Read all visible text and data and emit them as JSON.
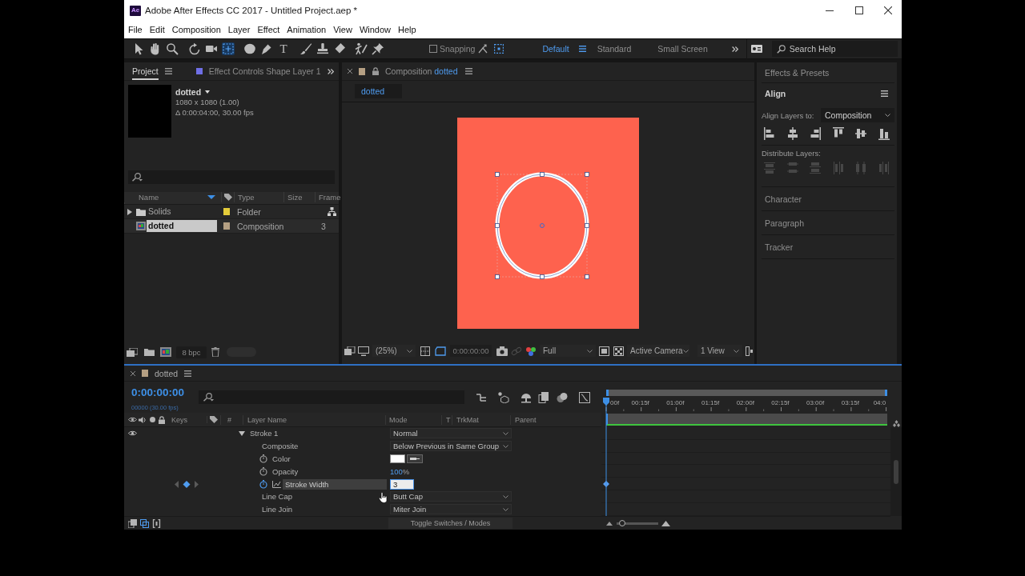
{
  "window": {
    "app_icon": "Ae",
    "title": "Adobe After Effects CC 2017 - Untitled Project.aep *"
  },
  "menu": [
    "File",
    "Edit",
    "Composition",
    "Layer",
    "Effect",
    "Animation",
    "View",
    "Window",
    "Help"
  ],
  "toolbar": {
    "tools": [
      {
        "kind": "selection",
        "selected": false
      },
      {
        "kind": "hand",
        "selected": false
      },
      {
        "kind": "zoom",
        "selected": false
      },
      {
        "kind": "rotate",
        "selected": false
      },
      {
        "kind": "camera",
        "selected": false
      },
      {
        "kind": "pan-behind",
        "selected": true
      },
      {
        "kind": "ellipse",
        "selected": false
      },
      {
        "kind": "pen",
        "selected": false
      },
      {
        "kind": "type",
        "glyph": "T",
        "selected": false
      },
      {
        "kind": "brush",
        "selected": false
      },
      {
        "kind": "stamp",
        "selected": false
      },
      {
        "kind": "eraser",
        "selected": false
      },
      {
        "kind": "roto",
        "selected": false
      },
      {
        "kind": "puppet",
        "selected": false
      }
    ],
    "snapping": {
      "label": "Snapping",
      "checked": false
    },
    "workspaces": [
      {
        "label": "Default",
        "selected": true
      },
      {
        "label": "Standard",
        "selected": false
      },
      {
        "label": "Small Screen",
        "selected": false
      }
    ],
    "search": {
      "placeholder": "Search Help"
    }
  },
  "project_panel": {
    "tabs": [
      {
        "label": "Project",
        "selected": true
      },
      {
        "label": "Effect Controls Shape Layer 1",
        "selected": false
      }
    ],
    "preview": {
      "name": "dotted",
      "details": [
        "1080 x 1080 (1.00)",
        "Δ 0:00:04:00, 30.00 fps"
      ]
    },
    "columns": [
      "Name",
      "Type",
      "Size",
      "Frame"
    ],
    "items": [
      {
        "kind": "folder",
        "name": "Solids",
        "color": "#e3cb3a",
        "type": "Folder",
        "expanded": false,
        "selected": false
      },
      {
        "kind": "composition",
        "name": "dotted",
        "color": "#b5a083",
        "type": "Composition",
        "frame": "3",
        "selected": true
      }
    ],
    "bit_depth": "8 bpc"
  },
  "composition_panel": {
    "tab": {
      "label": "Composition",
      "name": "dotted"
    },
    "breadcrumb": "dotted",
    "viewer_bar": {
      "zoom": "(25%)",
      "timecode": "0:00:00:00",
      "resolution": "Full",
      "camera": "Active Camera",
      "views": "1 View"
    }
  },
  "side_panels": [
    {
      "kind": "collapsed",
      "title": "Effects & Presets"
    },
    {
      "kind": "align",
      "title": "Align",
      "align_to_label": "Align Layers to:",
      "align_to": "Composition",
      "distribute_label": "Distribute Layers:",
      "distribute_disabled": true
    },
    {
      "kind": "collapsed",
      "title": "Character"
    },
    {
      "kind": "collapsed",
      "title": "Paragraph"
    },
    {
      "kind": "collapsed",
      "title": "Tracker"
    }
  ],
  "timeline": {
    "tab": "dotted",
    "timecode": "0:00:00:00",
    "frame_info": "00000 (30.00 fps)",
    "columns": [
      "Keys",
      "#",
      "Layer Name",
      "Mode",
      "T",
      "TrkMat",
      "Parent"
    ],
    "ruler": [
      "00f",
      "00:15f",
      "01:00f",
      "01:15f",
      "02:00f",
      "02:15f",
      "03:00f",
      "03:15f",
      "04:0"
    ],
    "rows": [
      {
        "kind": "group",
        "name": "Stroke 1",
        "expanded": true,
        "visible": true,
        "value": "Normal",
        "selected": false
      },
      {
        "kind": "option",
        "name": "Composite",
        "value": "Below Previous in Same Group",
        "selected": false
      },
      {
        "kind": "color",
        "name": "Color",
        "animated": false,
        "color": "#ffffff",
        "selected": false
      },
      {
        "kind": "number",
        "name": "Opacity",
        "animated": false,
        "value": "100",
        "unit": "%",
        "editing": false,
        "selected": false
      },
      {
        "kind": "number",
        "name": "Stroke Width",
        "animated": true,
        "value": "3",
        "editing": true,
        "selected": true
      },
      {
        "kind": "option",
        "name": "Line Cap",
        "value": "Butt Cap",
        "selected": false
      },
      {
        "kind": "option",
        "name": "Line Join",
        "value": "Miter Join",
        "selected": false
      }
    ],
    "toggle_label": "Toggle Switches / Modes",
    "zoom": {
      "level": 0.13
    }
  }
}
